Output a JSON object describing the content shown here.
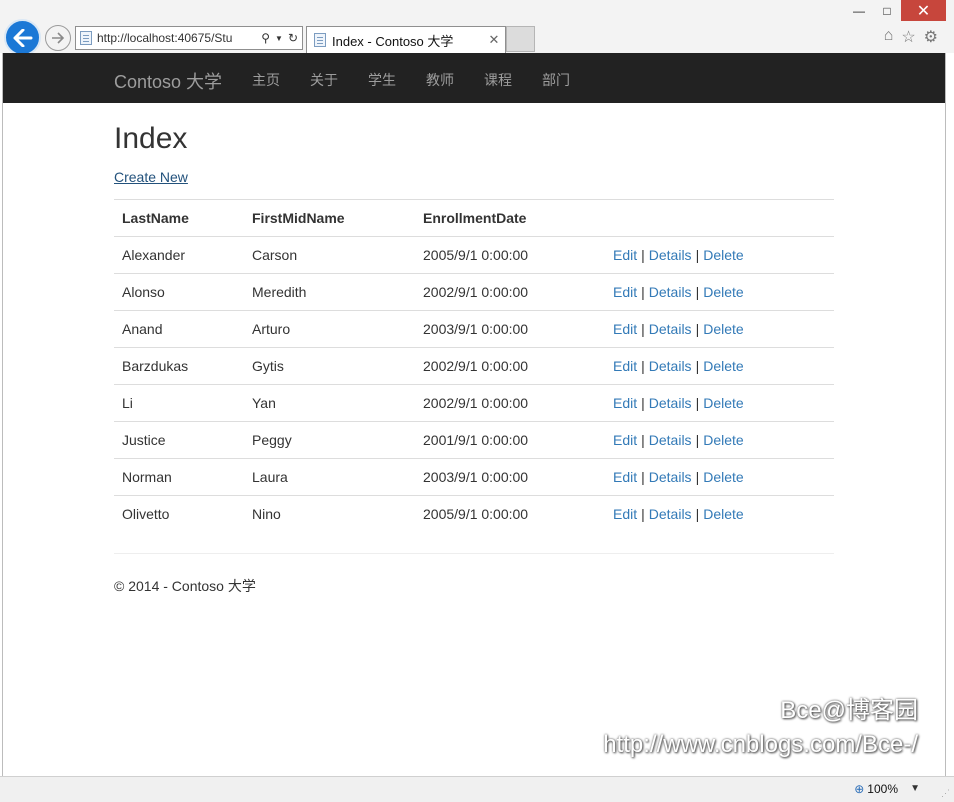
{
  "browser": {
    "url": "http://localhost:40675/Stu",
    "tab_title": "Index - Contoso 大学",
    "zoom": "100%"
  },
  "navbar": {
    "brand": "Contoso 大学",
    "items": [
      "主页",
      "关于",
      "学生",
      "教师",
      "课程",
      "部门"
    ]
  },
  "page": {
    "title": "Index",
    "create_new": "Create New"
  },
  "table": {
    "headers": [
      "LastName",
      "FirstMidName",
      "EnrollmentDate"
    ],
    "rows": [
      {
        "last": "Alexander",
        "first": "Carson",
        "date": "2005/9/1 0:00:00"
      },
      {
        "last": "Alonso",
        "first": "Meredith",
        "date": "2002/9/1 0:00:00"
      },
      {
        "last": "Anand",
        "first": "Arturo",
        "date": "2003/9/1 0:00:00"
      },
      {
        "last": "Barzdukas",
        "first": "Gytis",
        "date": "2002/9/1 0:00:00"
      },
      {
        "last": "Li",
        "first": "Yan",
        "date": "2002/9/1 0:00:00"
      },
      {
        "last": "Justice",
        "first": "Peggy",
        "date": "2001/9/1 0:00:00"
      },
      {
        "last": "Norman",
        "first": "Laura",
        "date": "2003/9/1 0:00:00"
      },
      {
        "last": "Olivetto",
        "first": "Nino",
        "date": "2005/9/1 0:00:00"
      }
    ],
    "actions": {
      "edit": "Edit",
      "details": "Details",
      "delete": "Delete",
      "separator": "|"
    }
  },
  "footer": "© 2014 - Contoso 大学",
  "watermark": {
    "line1": "Bce@博客园",
    "line2": "http://www.cnblogs.com/Bce-/"
  },
  "colors": {
    "navbar_bg": "#222222",
    "link": "#337ab7",
    "back_button": "#1b78d6",
    "close_button": "#c7463c"
  }
}
